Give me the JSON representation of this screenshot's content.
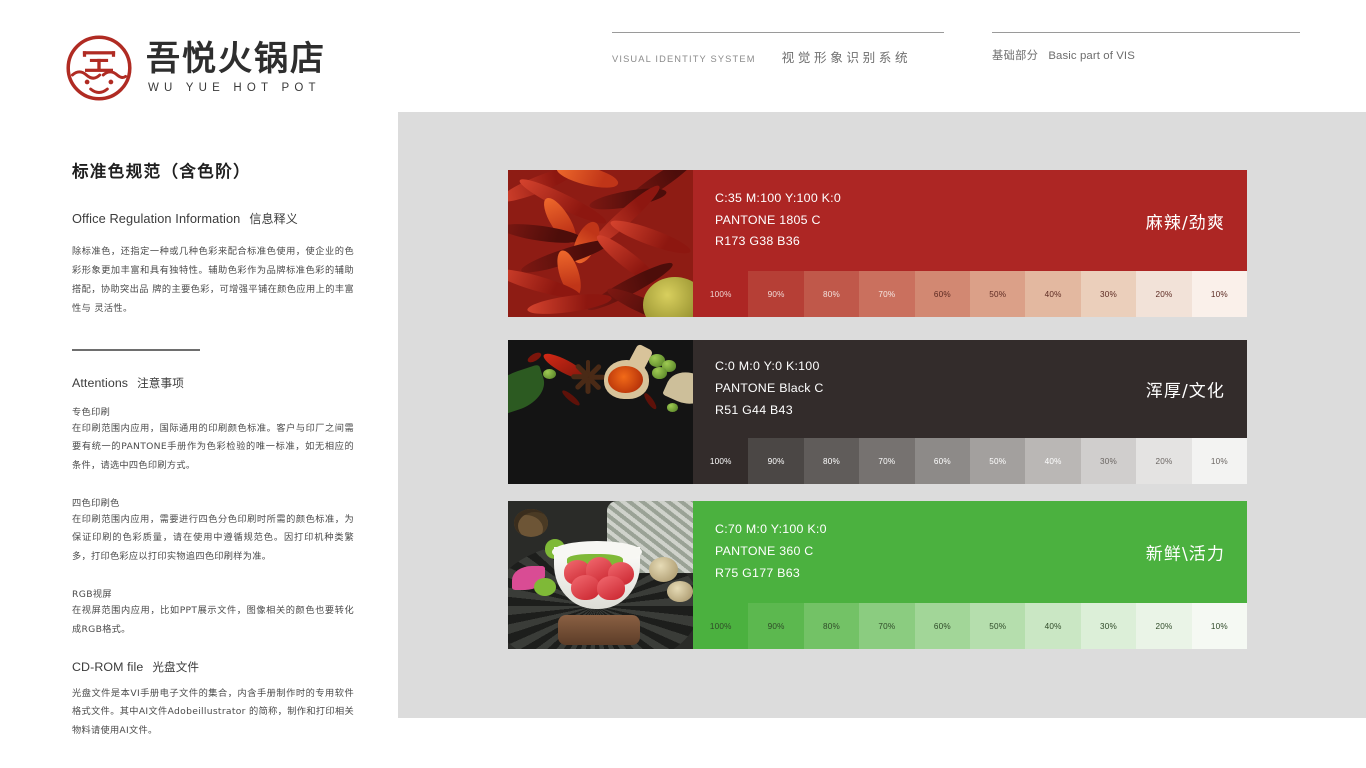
{
  "brand": {
    "logo_icon": "wuyue-seal-logo-icon",
    "name_cn": "吾悦火锅店",
    "name_en": "WU YUE HOT POT"
  },
  "header": {
    "left": {
      "en": "VISUAL IDENTITY SYSTEM",
      "cn": "视觉形象识别系统"
    },
    "right": {
      "cn": "基础部分",
      "en": "Basic part of VIS"
    }
  },
  "sidebar": {
    "section_title": "标准色规范（含色阶）",
    "subhead_en": "Office Regulation Information",
    "subhead_cn": "信息释义",
    "intro_paragraph": "除标准色，还指定一种或几种色彩来配合标准色使用，使企业的色彩形象更加丰富和具有独特性。辅助色彩作为品牌标准色彩的辅助搭配，协助突出品 牌的主要色彩，可增强平铺在颜色应用上的丰富性与 灵活性。",
    "attentions_en": "Attentions",
    "attentions_cn": "注意事项",
    "blocks": [
      {
        "heading": "专色印刷",
        "body": "在印刷范围内应用，国际通用的印刷颜色标准。客户与印厂之间需要有统一的PANTONE手册作为色彩检验的唯一标准，如无相应的条件，请选中四色印刷方式。"
      },
      {
        "heading": "四色印刷色",
        "body": "在印刷范围内应用，需要进行四色分色印刷时所需的颜色标准，为保证印刷的色彩质量，请在使用中遵循规范色。因打印机种类繁多，打印色彩应以打印实物追四色印刷样为准。"
      },
      {
        "heading": "RGB视屏",
        "body": "在视屏范围内应用，比如PPT展示文件，图像相关的颜色也要转化成RGB格式。"
      }
    ],
    "cdrom_en": "CD-ROM file",
    "cdrom_cn": "光盘文件",
    "cdrom_body": "光盘文件是本VI手册电子文件的集合，内含手册制作时的专用软件格式文件。其中AI文件Adobeillustrator 的简称，制作和打印相关物料请使用AI文件。"
  },
  "tint_labels": [
    "100%",
    "90%",
    "80%",
    "70%",
    "60%",
    "50%",
    "40%",
    "30%",
    "20%",
    "10%"
  ],
  "color_panels": [
    {
      "id": "primary-red",
      "photo_name": "dried-red-chili-photo",
      "cmyk": "C:35 M:100 Y:100 K:0",
      "pantone": "PANTONE 1805 C",
      "rgb": "R173 G38 B36",
      "slogan": "麻辣/劲爽",
      "base_hex": "#ad2624",
      "text_hex": "#ffffff",
      "tints": [
        {
          "label": "100%",
          "hex": "#ad2624",
          "text": "#efd6d3"
        },
        {
          "label": "90%",
          "hex": "#b63f36",
          "text": "#f0dcd8"
        },
        {
          "label": "80%",
          "hex": "#c0584a",
          "text": "#f2e1dd"
        },
        {
          "label": "70%",
          "hex": "#ca705e",
          "text": "#f6e8e4"
        },
        {
          "label": "60%",
          "hex": "#d28872",
          "text": "#5c2a22"
        },
        {
          "label": "50%",
          "hex": "#dba088",
          "text": "#5c2a22"
        },
        {
          "label": "40%",
          "hex": "#e3b8a0",
          "text": "#5c2a22"
        },
        {
          "label": "30%",
          "hex": "#ebcfbb",
          "text": "#5c2a22"
        },
        {
          "label": "20%",
          "hex": "#f2e2d8",
          "text": "#5c2a22"
        },
        {
          "label": "10%",
          "hex": "#faf0ea",
          "text": "#5c2a22"
        }
      ]
    },
    {
      "id": "primary-black",
      "photo_name": "dark-spice-board-photo",
      "cmyk": "C:0 M:0 Y:0 K:100",
      "pantone": "PANTONE Black C",
      "rgb": "R51 G44 B43",
      "slogan": "浑厚/文化",
      "base_hex": "#332c2b",
      "text_hex": "#ffffff",
      "tints": [
        {
          "label": "100%",
          "hex": "#332c2b",
          "text": "#ffffff"
        },
        {
          "label": "90%",
          "hex": "#4b4745",
          "text": "#ffffff"
        },
        {
          "label": "80%",
          "hex": "#605c5a",
          "text": "#ffffff"
        },
        {
          "label": "70%",
          "hex": "#767270",
          "text": "#ffffff"
        },
        {
          "label": "60%",
          "hex": "#8d8a88",
          "text": "#ffffff"
        },
        {
          "label": "50%",
          "hex": "#a3a09e",
          "text": "#ffffff"
        },
        {
          "label": "40%",
          "hex": "#bab7b5",
          "text": "#ffffff"
        },
        {
          "label": "30%",
          "hex": "#d0cecd",
          "text": "#6b6663"
        },
        {
          "label": "20%",
          "hex": "#e4e3e2",
          "text": "#6b6663"
        },
        {
          "label": "10%",
          "hex": "#f3f3f2",
          "text": "#6b6663"
        }
      ]
    },
    {
      "id": "primary-green",
      "photo_name": "hotpot-dish-photo",
      "cmyk": "C:70 M:0 Y:100 K:0",
      "pantone": "PANTONE 360 C",
      "rgb": "R75 G177 B63",
      "slogan": "新鲜\\活力",
      "base_hex": "#4bb13f",
      "text_hex": "#ffffff",
      "tints": [
        {
          "label": "100%",
          "hex": "#4bb13f",
          "text": "#2f4a28"
        },
        {
          "label": "90%",
          "hex": "#5cb84f",
          "text": "#2f4a28"
        },
        {
          "label": "80%",
          "hex": "#73c266",
          "text": "#2f4a28"
        },
        {
          "label": "70%",
          "hex": "#8bcc80",
          "text": "#2f4a28"
        },
        {
          "label": "60%",
          "hex": "#a2d698",
          "text": "#2f4a28"
        },
        {
          "label": "50%",
          "hex": "#b5de ad",
          "text": "#2f4a28"
        },
        {
          "label": "40%",
          "hex": "#cae7c4",
          "text": "#2f4a28"
        },
        {
          "label": "30%",
          "hex": "#dcefd8",
          "text": "#2f4a28"
        },
        {
          "label": "20%",
          "hex": "#eaf4e7",
          "text": "#2f4a28"
        },
        {
          "label": "10%",
          "hex": "#f5f9f3",
          "text": "#2f4a28"
        }
      ]
    }
  ]
}
